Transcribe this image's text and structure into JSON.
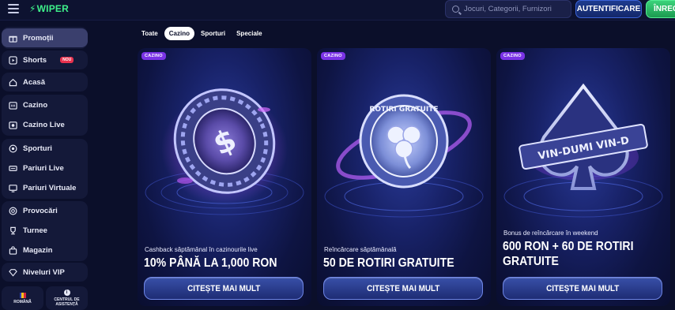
{
  "header": {
    "logo": "WIPER",
    "search_placeholder": "Jocuri, Categorii, Furnizori",
    "auth_label": "AUTENTIFICARE",
    "register_label": "ÎNREGI"
  },
  "sidebar": {
    "items": [
      {
        "label": "Promoții",
        "icon": "gift-icon"
      },
      {
        "label": "Shorts",
        "icon": "play-icon",
        "badge": "NOU"
      },
      {
        "label": "Acasă",
        "icon": "home-icon"
      },
      {
        "label": "Cazino",
        "icon": "slot-machine-icon"
      },
      {
        "label": "Cazino Live",
        "icon": "live-casino-icon"
      },
      {
        "label": "Sporturi",
        "icon": "soccer-ball-icon"
      },
      {
        "label": "Pariuri Live",
        "icon": "live-bets-icon"
      },
      {
        "label": "Pariuri Virtuale",
        "icon": "virtual-bets-icon"
      },
      {
        "label": "Provocări",
        "icon": "target-icon"
      },
      {
        "label": "Turnee",
        "icon": "trophy-icon"
      },
      {
        "label": "Magazin",
        "icon": "shopping-bag-icon"
      },
      {
        "label": "Niveluri VIP",
        "icon": "diamond-icon"
      }
    ],
    "language_label": "ROMÂNĂ",
    "help_label_1": "CENTRUL DE",
    "help_label_2": "ASISTENȚĂ"
  },
  "tabs": [
    {
      "label": "Toate",
      "active": false
    },
    {
      "label": "Cazino",
      "active": true
    },
    {
      "label": "Sporturi",
      "active": false
    },
    {
      "label": "Speciale",
      "active": false
    }
  ],
  "cards": [
    {
      "badge": "CAZINO",
      "subtitle": "Cashback săptămânal în cazinourile live",
      "title_1": "10% PÂNĂ LA 1,000 RON",
      "title_2": "",
      "button": "CITEȘTE MAI MULT",
      "art": "dollar-chip-art"
    },
    {
      "badge": "CAZINO",
      "subtitle": "Reîncărcare săptămânală",
      "title_1": "50 DE ROTIRI GRATUITE",
      "title_2": "",
      "button": "CITEȘTE MAI MULT",
      "art": "clover-coin-art",
      "art_text": "ROTIRI GRATUITE"
    },
    {
      "badge": "CAZINO",
      "subtitle": "Bonus de reîncărcare în weekend",
      "title_1": "600 RON + 60 DE ROTIRI",
      "title_2": "GRATUITE",
      "button": "CITEȘTE MAI MULT",
      "art": "spade-emblem-art",
      "art_text": "VIN-DUMI VIN-D"
    }
  ],
  "colors": {
    "background": "#0b0f2a",
    "accent_green": "#3ef08a",
    "badge_purple": "#7a33e6",
    "auth_blue": "#1d3b8f"
  }
}
